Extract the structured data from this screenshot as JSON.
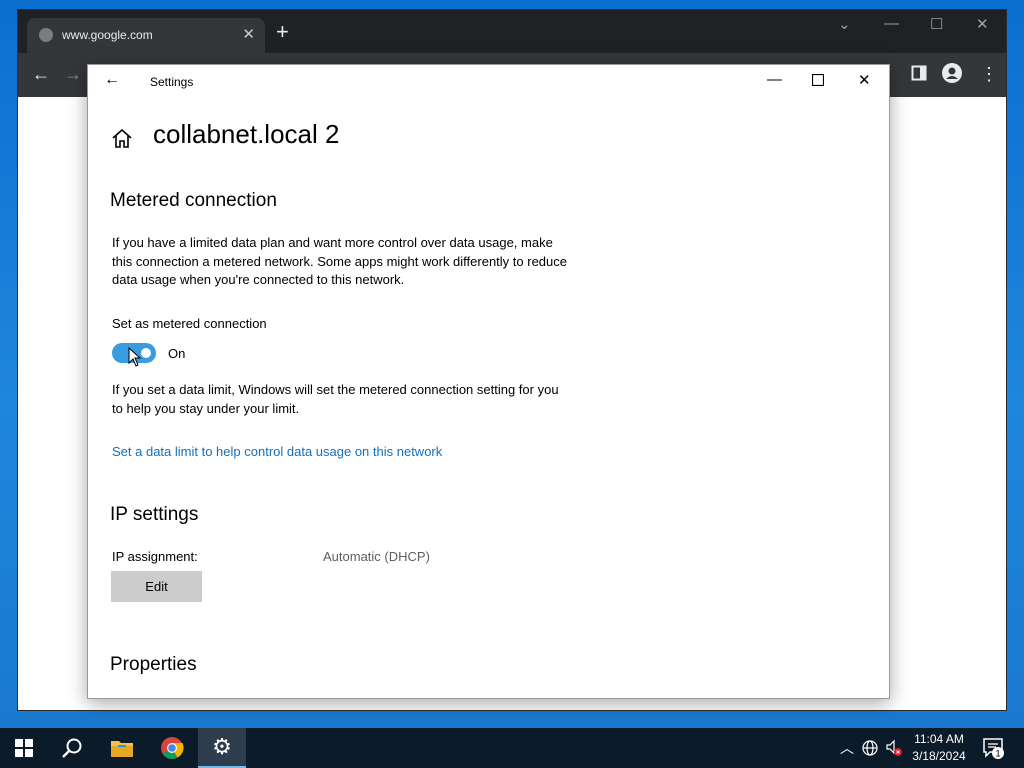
{
  "browser": {
    "tab_title": "www.google.com",
    "tab_close": "✕",
    "new_tab": "+",
    "minimize": "—",
    "maximize": "☐",
    "close": "✕"
  },
  "settings": {
    "window_title": "Settings",
    "page_title": "collabnet.local 2",
    "metered": {
      "heading": "Metered connection",
      "description": "If you have a limited data plan and want more control over data usage, make this connection a metered network. Some apps might work differently to reduce data usage when you're connected to this network.",
      "toggle_label": "Set as metered connection",
      "toggle_on": true,
      "toggle_state": "On",
      "limit_note": "If you set a data limit, Windows will set the metered connection setting for you to help you stay under your limit.",
      "data_limit_link": "Set a data limit to help control data usage on this network"
    },
    "ip": {
      "heading": "IP settings",
      "assignment_label": "IP assignment:",
      "assignment_value": "Automatic (DHCP)",
      "edit_label": "Edit"
    },
    "properties_heading": "Properties"
  },
  "taskbar": {
    "time": "11:04 AM",
    "date": "3/18/2024",
    "notification_count": "1"
  },
  "colors": {
    "accent": "#3a9be0",
    "link": "#1670b8",
    "taskbar": "#0c1b2a"
  }
}
